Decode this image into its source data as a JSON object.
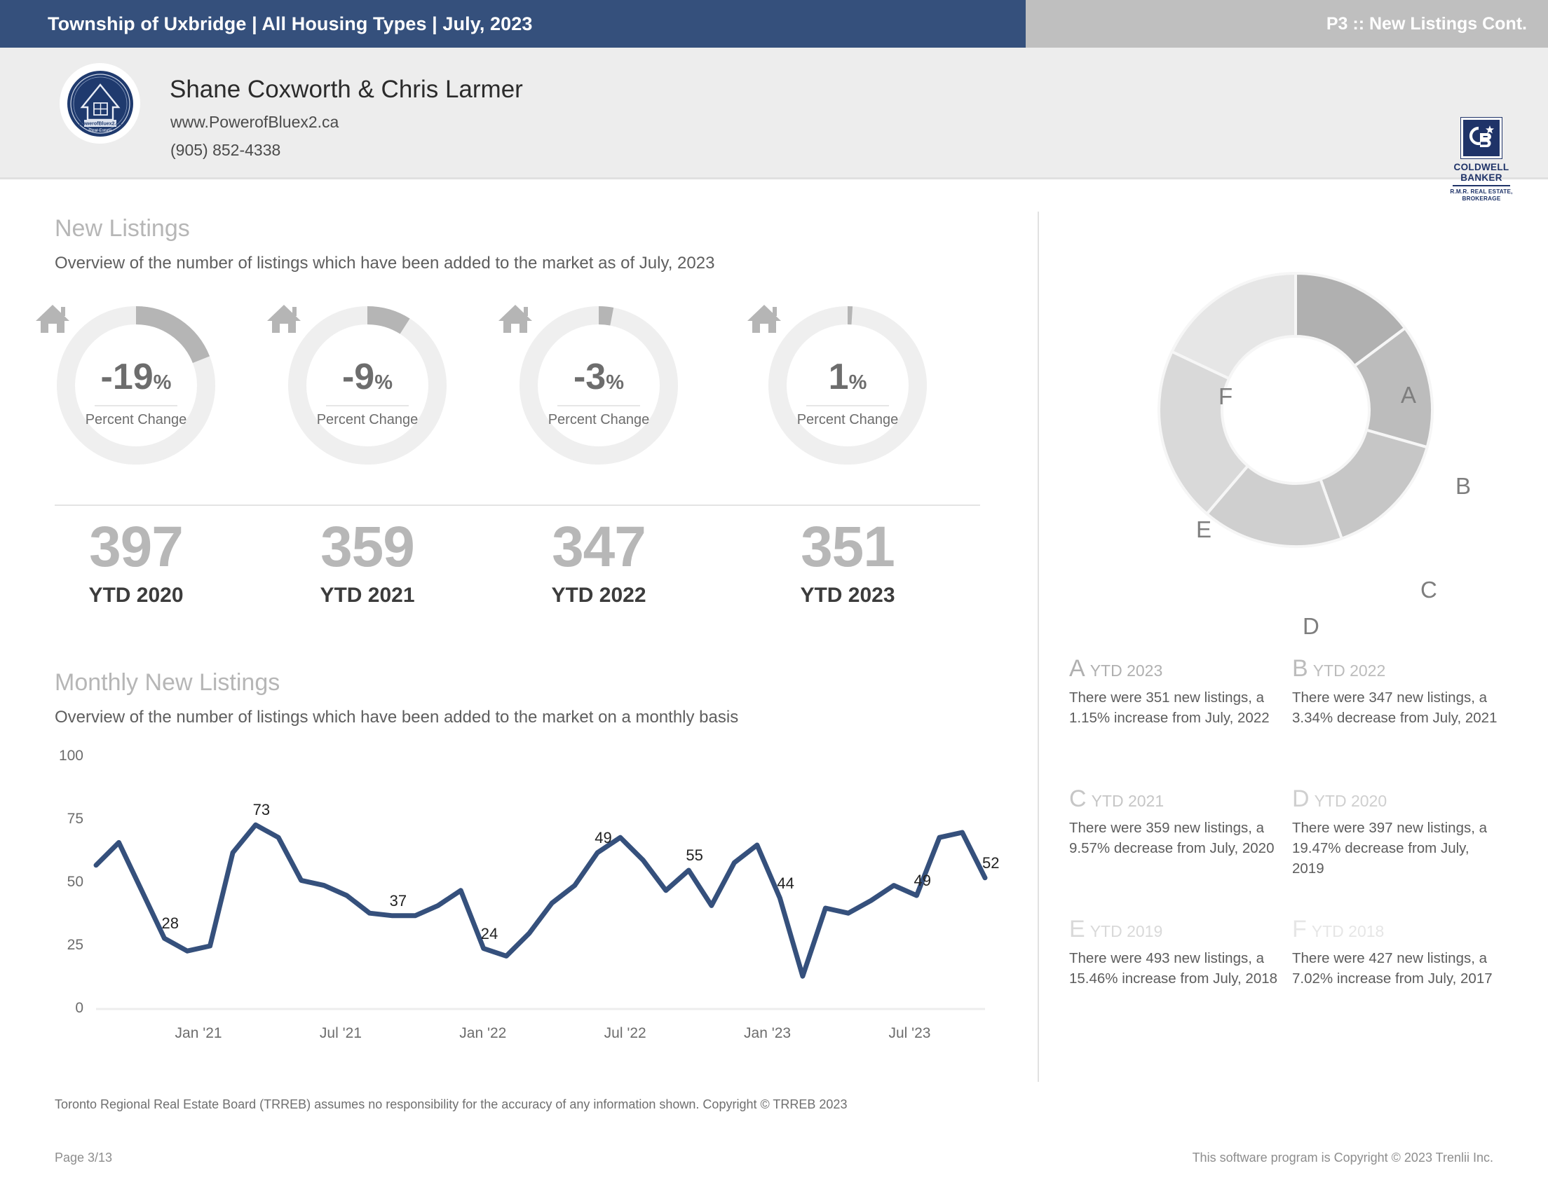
{
  "header": {
    "title": "Township of Uxbridge | All Housing Types | July, 2023",
    "page_tag": "P3 :: New Listings Cont."
  },
  "agent": {
    "name": "Shane Coxworth & Chris Larmer",
    "website": "www.PowerofBluex2.ca",
    "phone": "(905) 852-4338",
    "logo_icon": "circular-house-badge-logo"
  },
  "brokerage": {
    "mark_icon": "coldwell-banker-cb-star-mark",
    "name_line1": "COLDWELL",
    "name_line2": "BANKER",
    "sub_line1": "R.M.R. REAL ESTATE,",
    "sub_line2": "BROKERAGE"
  },
  "new_listings": {
    "title": "New Listings",
    "subtitle": "Overview of the number of listings which have been added to the market as of July, 2023",
    "gauges": [
      {
        "value": "-19",
        "unit": "%",
        "label": "Percent Change",
        "percent": -19,
        "icon": "house-icon"
      },
      {
        "value": "-9",
        "unit": "%",
        "label": "Percent Change",
        "percent": -9,
        "icon": "house-icon"
      },
      {
        "value": "-3",
        "unit": "%",
        "label": "Percent Change",
        "percent": -3,
        "icon": "house-icon"
      },
      {
        "value": "1",
        "unit": "%",
        "label": "Percent Change",
        "percent": 1,
        "icon": "house-icon"
      }
    ],
    "ytd": [
      {
        "number": "397",
        "label": "YTD 2020"
      },
      {
        "number": "359",
        "label": "YTD 2021"
      },
      {
        "number": "347",
        "label": "YTD 2022"
      },
      {
        "number": "351",
        "label": "YTD 2023"
      }
    ]
  },
  "monthly": {
    "title": "Monthly New Listings",
    "subtitle": "Overview of the number of listings which have been added to the market on a monthly basis"
  },
  "chart_data": {
    "type": "line",
    "title": "Monthly New Listings",
    "xlabel": "",
    "ylabel": "",
    "ylim": [
      0,
      100
    ],
    "yticks": [
      0,
      25,
      50,
      75,
      100
    ],
    "xtick_labels": [
      "Jan '21",
      "Jul '21",
      "Jan '22",
      "Jul '22",
      "Jan '23",
      "Jul '23"
    ],
    "grid": false,
    "line_color": "#35507c",
    "x": [
      "Aug '20",
      "Sep '20",
      "Oct '20",
      "Nov '20",
      "Dec '20",
      "Jan '21",
      "Feb '21",
      "Mar '21",
      "Apr '21",
      "May '21",
      "Jun '21",
      "Jul '21",
      "Aug '21",
      "Sep '21",
      "Oct '21",
      "Nov '21",
      "Dec '21",
      "Jan '22",
      "Feb '22",
      "Mar '22",
      "Apr '22",
      "May '22",
      "Jun '22",
      "Jul '22",
      "Aug '22",
      "Sep '22",
      "Oct '22",
      "Nov '22",
      "Dec '22",
      "Jan '23",
      "Feb '23",
      "Mar '23",
      "Apr '23",
      "May '23",
      "Jun '23",
      "Jul '23"
    ],
    "values": [
      57,
      66,
      47,
      28,
      23,
      25,
      62,
      73,
      68,
      51,
      49,
      45,
      38,
      37,
      37,
      41,
      47,
      24,
      21,
      30,
      42,
      49,
      62,
      68,
      59,
      47,
      55,
      41,
      58,
      65,
      44,
      13,
      40,
      38,
      43,
      49,
      45,
      68,
      70,
      52
    ],
    "point_labels": [
      {
        "index": 3,
        "label": "28"
      },
      {
        "index": 7,
        "label": "73"
      },
      {
        "index": 13,
        "label": "37"
      },
      {
        "index": 17,
        "label": "24"
      },
      {
        "index": 22,
        "label": "49"
      },
      {
        "index": 26,
        "label": "55"
      },
      {
        "index": 30,
        "label": "44"
      },
      {
        "index": 36,
        "label": "49"
      },
      {
        "index": 39,
        "label": "52"
      }
    ]
  },
  "donut": {
    "type": "doughnut",
    "segment_labels": [
      "A",
      "B",
      "C",
      "D",
      "E",
      "F"
    ],
    "segments": [
      {
        "key": "A",
        "year": "YTD 2023",
        "value": 351,
        "color": "#b0b0b0"
      },
      {
        "key": "B",
        "year": "YTD 2022",
        "value": 347,
        "color": "#bcbcbc"
      },
      {
        "key": "C",
        "year": "YTD 2021",
        "value": 359,
        "color": "#c6c6c6"
      },
      {
        "key": "D",
        "year": "YTD 2020",
        "value": 397,
        "color": "#cfcfcf"
      },
      {
        "key": "E",
        "year": "YTD 2019",
        "value": 493,
        "color": "#d9d9d9"
      },
      {
        "key": "F",
        "year": "YTD 2018",
        "value": 427,
        "color": "#e6e6e6"
      }
    ]
  },
  "legend": [
    {
      "letter": "A",
      "year": "YTD 2023",
      "text": "There were 351 new listings, a 1.15% increase from July, 2022",
      "letter_color": "#b0b0b0"
    },
    {
      "letter": "B",
      "year": "YTD 2022",
      "text": "There were 347 new listings, a 3.34% decrease from July, 2021",
      "letter_color": "#bcbcbc"
    },
    {
      "letter": "C",
      "year": "YTD 2021",
      "text": "There were 359 new listings, a 9.57% decrease from July, 2020",
      "letter_color": "#c6c6c6"
    },
    {
      "letter": "D",
      "year": "YTD 2020",
      "text": "There were 397 new listings, a 19.47% decrease from July, 2019",
      "letter_color": "#cfcfcf"
    },
    {
      "letter": "E",
      "year": "YTD 2019",
      "text": "There were 493 new listings, a 15.46% increase from July, 2018",
      "letter_color": "#d9d9d9"
    },
    {
      "letter": "F",
      "year": "YTD 2018",
      "text": "There were 427 new listings, a 7.02% increase from July, 2017",
      "letter_color": "#e6e6e6"
    }
  ],
  "footer": {
    "disclaimer": "Toronto Regional Real Estate Board (TRREB) assumes no responsibility for the accuracy of any information shown. Copyright © TRREB 2023",
    "page": "Page 3/13",
    "copyright": "This software program is Copyright © 2023 Trenlii Inc."
  },
  "colors": {
    "navy": "#35507c",
    "header_gray": "#bfbfbf",
    "agent_bar": "#ededed",
    "gauge_track": "#efefef",
    "gauge_fill": "#b5b5b5"
  }
}
